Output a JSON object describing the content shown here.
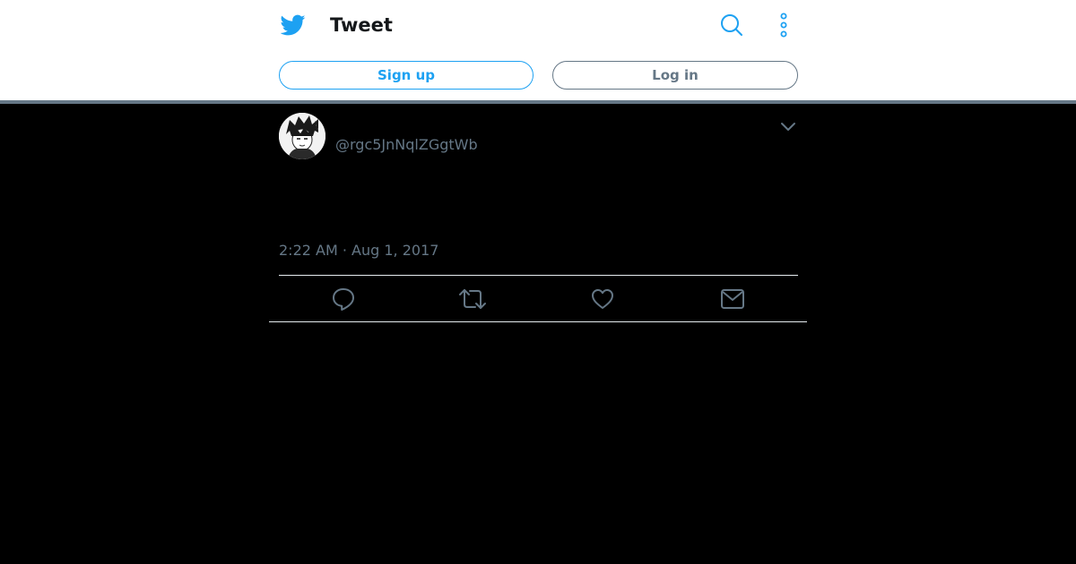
{
  "header": {
    "title": "Tweet",
    "brand_icon": "twitter-bird-icon",
    "search_icon": "search-icon",
    "more_icon": "more-vertical-icon",
    "accent_color": "#1da1f2"
  },
  "auth": {
    "signup_label": "Sign up",
    "login_label": "Log in"
  },
  "tweet": {
    "display_name": "",
    "handle": "@rgc5JnNqlZGgtWb",
    "timestamp": "2:22 AM · Aug 1, 2017",
    "text": "",
    "caret_icon": "chevron-down-icon"
  },
  "actions": [
    {
      "icon": "reply-icon"
    },
    {
      "icon": "retweet-icon"
    },
    {
      "icon": "like-icon"
    },
    {
      "icon": "direct-message-icon"
    }
  ]
}
